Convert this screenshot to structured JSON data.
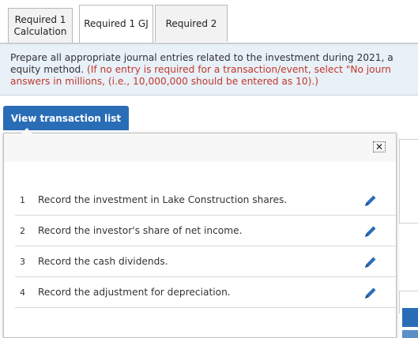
{
  "tabs": [
    {
      "label_line1": "Required 1",
      "label_line2": "Calculation"
    },
    {
      "label": "Required 1 GJ"
    },
    {
      "label": "Required 2"
    }
  ],
  "instructions": {
    "line1": "Prepare all appropriate journal entries related to the investment during 2021, a",
    "line2_black": "equity method. ",
    "line2_red": "(If no entry is required for a transaction/event, select \"No journ",
    "line3_red": "answers in millions, (i.e., 10,000,000 should be entered as 10).)"
  },
  "view_button": {
    "label": "View transaction list"
  },
  "close_icon": "close-icon",
  "transactions": [
    {
      "number": "1",
      "description": "Record the investment in Lake Construction shares."
    },
    {
      "number": "2",
      "description": "Record the investor's share of net income."
    },
    {
      "number": "3",
      "description": "Record the cash dividends."
    },
    {
      "number": "4",
      "description": "Record the adjustment for depreciation."
    }
  ],
  "colors": {
    "accent": "#2a6db7",
    "instruction_red": "#c0392b",
    "instruction_bg": "#e8f0f8"
  }
}
